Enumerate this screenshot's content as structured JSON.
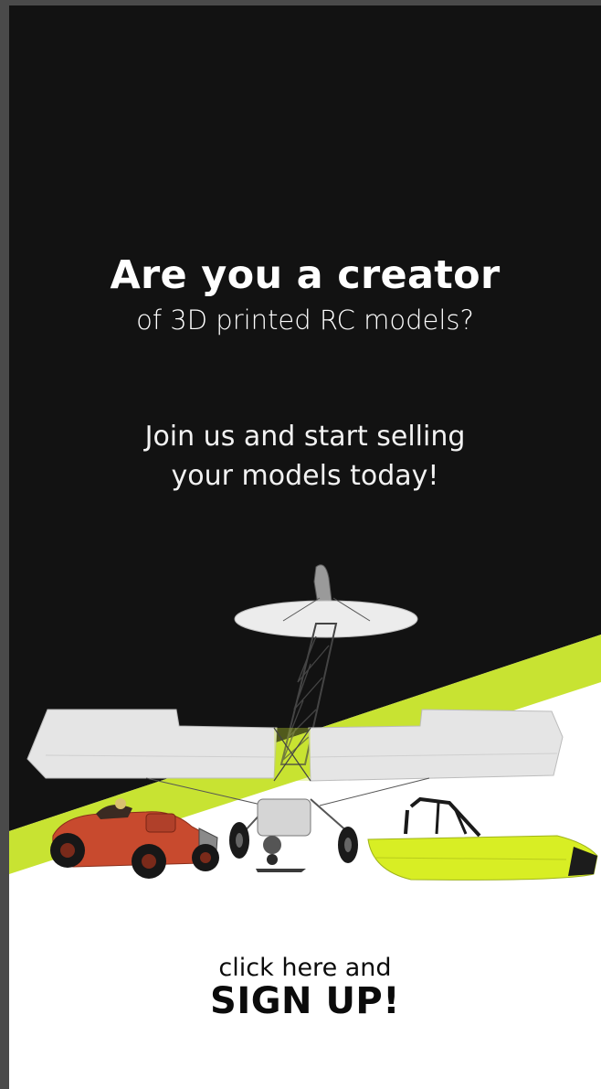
{
  "promo": {
    "headline": "Are you a creator",
    "subheadline": "of 3D printed RC models?",
    "pitch_line1": "Join us and start selling",
    "pitch_line2": "your models today!"
  },
  "cta": {
    "prefix": "click here and",
    "action": "SIGN UP!"
  },
  "colors": {
    "background": "#121212",
    "accent": "#c8e332",
    "boat": "#d8ee24",
    "car": "#c84a2e",
    "cta_text": "#0b0b0b"
  },
  "icons": [
    "rc-plane-icon",
    "rc-car-icon",
    "rc-boat-icon"
  ]
}
